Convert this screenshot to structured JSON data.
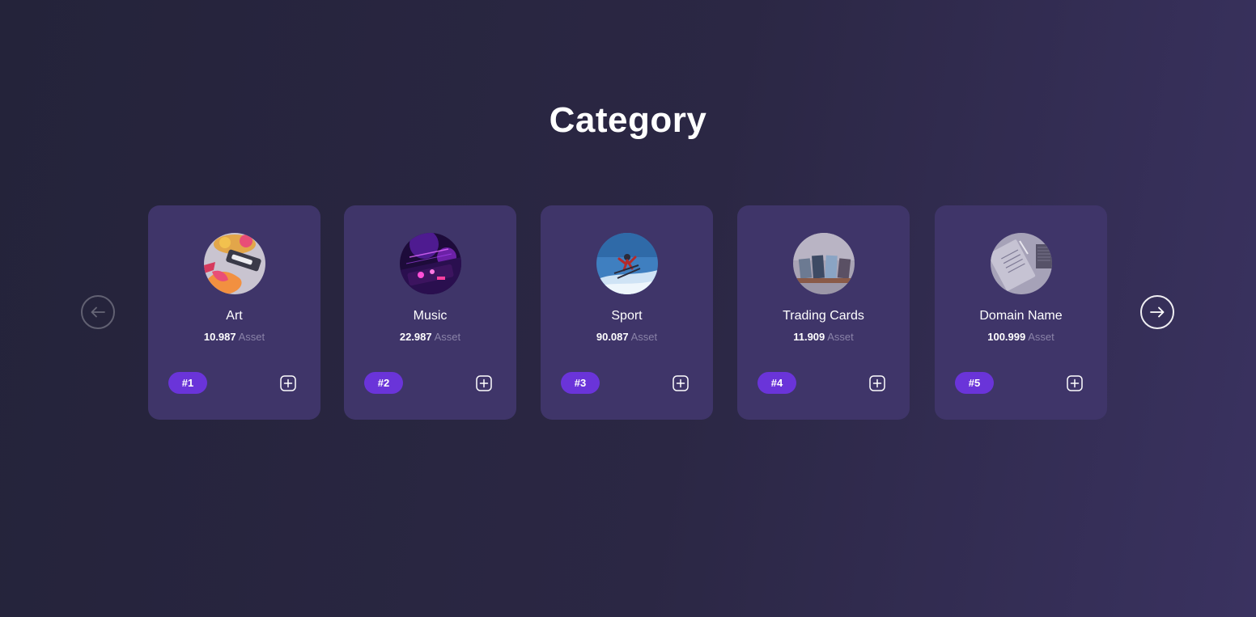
{
  "page": {
    "title": "Category"
  },
  "nav": {
    "prev_icon": "arrow-left-icon",
    "next_icon": "arrow-right-icon"
  },
  "colors": {
    "card_background": "#3f3569",
    "badge_background": "#6a34d9",
    "asset_label": "#8a83a8"
  },
  "categories": [
    {
      "name": "Art",
      "asset_count": "10.987",
      "asset_label": "Asset",
      "rank": "#1",
      "image": "art-thumbnail",
      "add_icon": "plus-square-icon"
    },
    {
      "name": "Music",
      "asset_count": "22.987",
      "asset_label": "Asset",
      "rank": "#2",
      "image": "music-thumbnail",
      "add_icon": "plus-square-icon"
    },
    {
      "name": "Sport",
      "asset_count": "90.087",
      "asset_label": "Asset",
      "rank": "#3",
      "image": "sport-thumbnail",
      "add_icon": "plus-square-icon"
    },
    {
      "name": "Trading Cards",
      "asset_count": "11.909",
      "asset_label": "Asset",
      "rank": "#4",
      "image": "trading-cards-thumbnail",
      "add_icon": "plus-square-icon"
    },
    {
      "name": "Domain Name",
      "asset_count": "100.999",
      "asset_label": "Asset",
      "rank": "#5",
      "image": "domain-name-thumbnail",
      "add_icon": "plus-square-icon"
    }
  ]
}
